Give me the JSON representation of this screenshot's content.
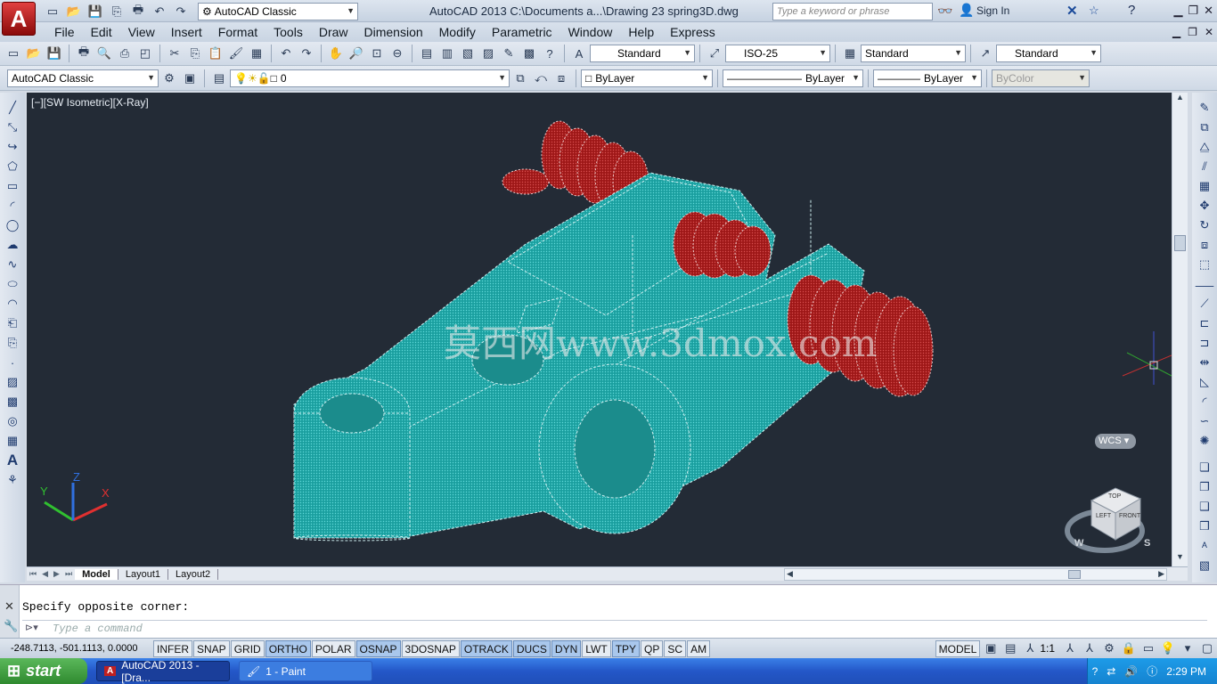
{
  "app": {
    "title": "AutoCAD 2013    C:\\Documents a...\\Drawing 23 spring3D.dwg",
    "workspace": "AutoCAD Classic",
    "search_placeholder": "Type a keyword or phrase",
    "signin": "Sign In",
    "logo_letter": "A"
  },
  "menu": [
    "File",
    "Edit",
    "View",
    "Insert",
    "Format",
    "Tools",
    "Draw",
    "Dimension",
    "Modify",
    "Parametric",
    "Window",
    "Help",
    "Express"
  ],
  "styles_toolbar": {
    "text_style": "Standard",
    "dim_style": "ISO-25",
    "table_style": "Standard",
    "multileader_style": "Standard"
  },
  "layers_toolbar": {
    "workspace": "AutoCAD Classic",
    "layer": "0",
    "color": "ByLayer",
    "linetype": "ByLayer",
    "lineweight": "ByLayer",
    "plot_style": "ByColor"
  },
  "viewport": {
    "label": "[−][SW Isometric][X-Ray]",
    "watermark": "莫西网www.3dmox.com",
    "wcs": "WCS",
    "ucs_axes": {
      "x": "X",
      "y": "Y",
      "z": "Z"
    },
    "viewcube": {
      "top": "TOP",
      "left": "LEFT",
      "front": "FRONT"
    },
    "compass": {
      "w": "W",
      "s": "S"
    },
    "colors": {
      "background": "#232b36",
      "model": "#1fa5a5",
      "springs": "#a81c1c"
    }
  },
  "layout_tabs": [
    "Model",
    "Layout1",
    "Layout2"
  ],
  "command": {
    "history": "Specify opposite corner:",
    "placeholder": "Type a command"
  },
  "status": {
    "coords": "-248.7113, -501.1113, 0.0000",
    "toggles": [
      {
        "label": "INFER",
        "on": false
      },
      {
        "label": "SNAP",
        "on": false
      },
      {
        "label": "GRID",
        "on": false
      },
      {
        "label": "ORTHO",
        "on": true
      },
      {
        "label": "POLAR",
        "on": false
      },
      {
        "label": "OSNAP",
        "on": true
      },
      {
        "label": "3DOSNAP",
        "on": false
      },
      {
        "label": "OTRACK",
        "on": true
      },
      {
        "label": "DUCS",
        "on": true
      },
      {
        "label": "DYN",
        "on": true
      },
      {
        "label": "LWT",
        "on": false
      },
      {
        "label": "TPY",
        "on": true
      },
      {
        "label": "QP",
        "on": false
      },
      {
        "label": "SC",
        "on": false
      },
      {
        "label": "AM",
        "on": false
      }
    ],
    "model": "MODEL",
    "scale": "1:1"
  },
  "taskbar": {
    "start": "start",
    "tasks": [
      "AutoCAD 2013 - [Dra...",
      "1 - Paint"
    ],
    "time": "2:29 PM"
  }
}
